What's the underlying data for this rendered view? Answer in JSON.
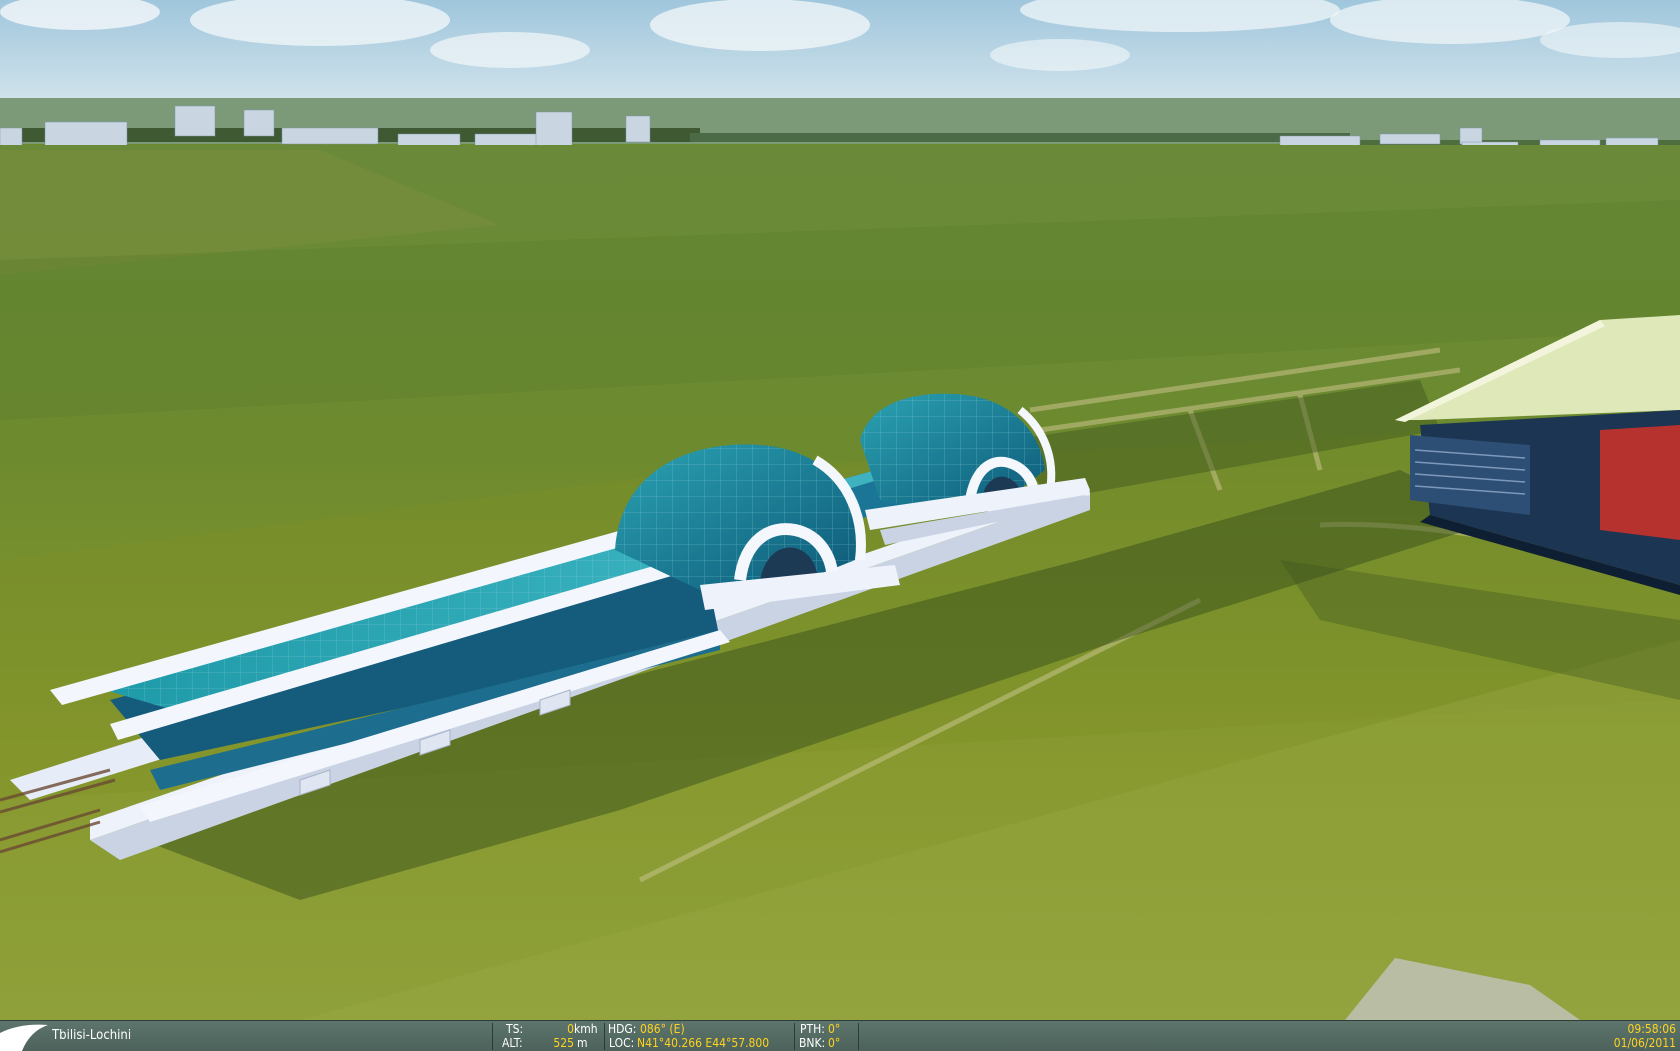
{
  "status_bar": {
    "location": "Tbilisi-Lochini",
    "ts_label": "TS:",
    "ts_value": "0",
    "ts_unit": "kmh",
    "alt_label": "ALT:",
    "alt_value": "525",
    "alt_unit": "m",
    "hdg_label": "HDG:",
    "hdg_value": "086° (E)",
    "loc_label": "LOC:",
    "loc_value": "N41°40.266 E44°57.800",
    "pth_label": "PTH:",
    "pth_value": "0°",
    "bnk_label": "BNK:",
    "bnk_value": "0°",
    "time": "09:58:06",
    "date": "01/06/2011"
  },
  "colors": {
    "status_bg": "#546b62",
    "value_text": "#ffd21f",
    "label_text": "#ffffff"
  }
}
